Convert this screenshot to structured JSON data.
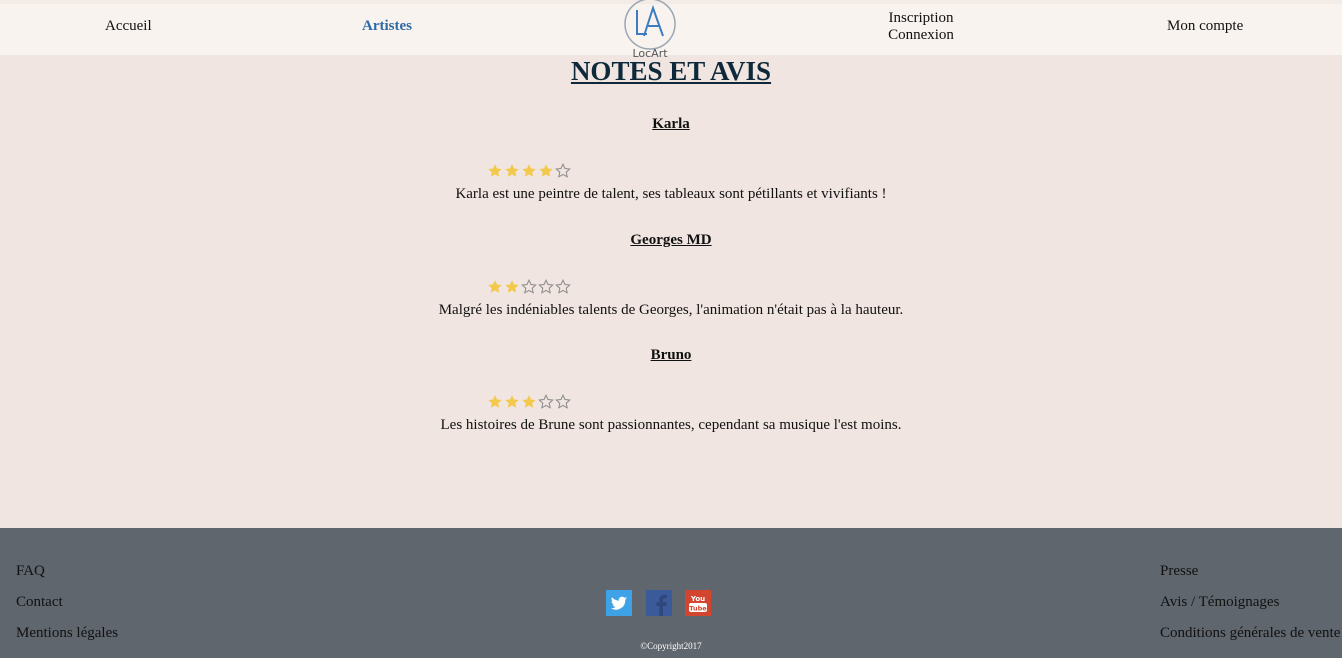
{
  "nav": {
    "accueil": "Accueil",
    "artistes": "Artistes",
    "inscription": "Inscription",
    "connexion": "Connexion",
    "mon_compte": "Mon compte",
    "logo_text": "LocArt",
    "logo_mark": "LA"
  },
  "page_title": "NOTES ET AVIS",
  "reviews": [
    {
      "author": "Karla",
      "rating": 4,
      "max": 5,
      "comment": "Karla est une peintre de talent, ses tableaux sont pétillants et vivifiants !"
    },
    {
      "author": "Georges MD",
      "rating": 2,
      "max": 5,
      "comment": "Malgré les indéniables talents de Georges, l'animation n'était pas à la hauteur."
    },
    {
      "author": "Bruno",
      "rating": 3,
      "max": 5,
      "comment": "Les histoires de Brune sont passionnantes, cependant sa musique l'est moins."
    }
  ],
  "footer": {
    "left": [
      "FAQ",
      "Contact",
      "Mentions légales"
    ],
    "right": [
      "Presse",
      "Avis / Témoignages",
      "Conditions générales de vente"
    ],
    "social": [
      "twitter-icon",
      "facebook-icon",
      "youtube-icon"
    ],
    "copyright": "©Copyright2017"
  },
  "colors": {
    "page_bg": "#f0e5e0",
    "header_bg": "#f8f3ef",
    "footer_bg": "#60666e",
    "active_nav": "#2e6aa6",
    "star_filled": "#f2c94c",
    "star_empty": "#8a8a8a"
  }
}
